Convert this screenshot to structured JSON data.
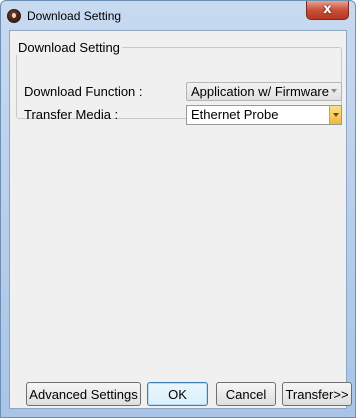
{
  "window": {
    "title": "Download Setting",
    "close_glyph": "x",
    "icon": "app-icon"
  },
  "group": {
    "title": "Download Setting"
  },
  "fields": {
    "download_function": {
      "label": "Download Function :",
      "value": "Application w/ Firmware"
    },
    "transfer_media": {
      "label": "Transfer Media :",
      "value": "Ethernet Probe"
    }
  },
  "buttons": {
    "advanced": "Advanced Settings",
    "ok": "OK",
    "cancel": "Cancel",
    "transfer": "Transfer>>"
  },
  "colors": {
    "frame": "#a9c4e6",
    "client": "#f0f0f0",
    "close": "#c9503b",
    "dropdown_button": "#f1b93a"
  }
}
